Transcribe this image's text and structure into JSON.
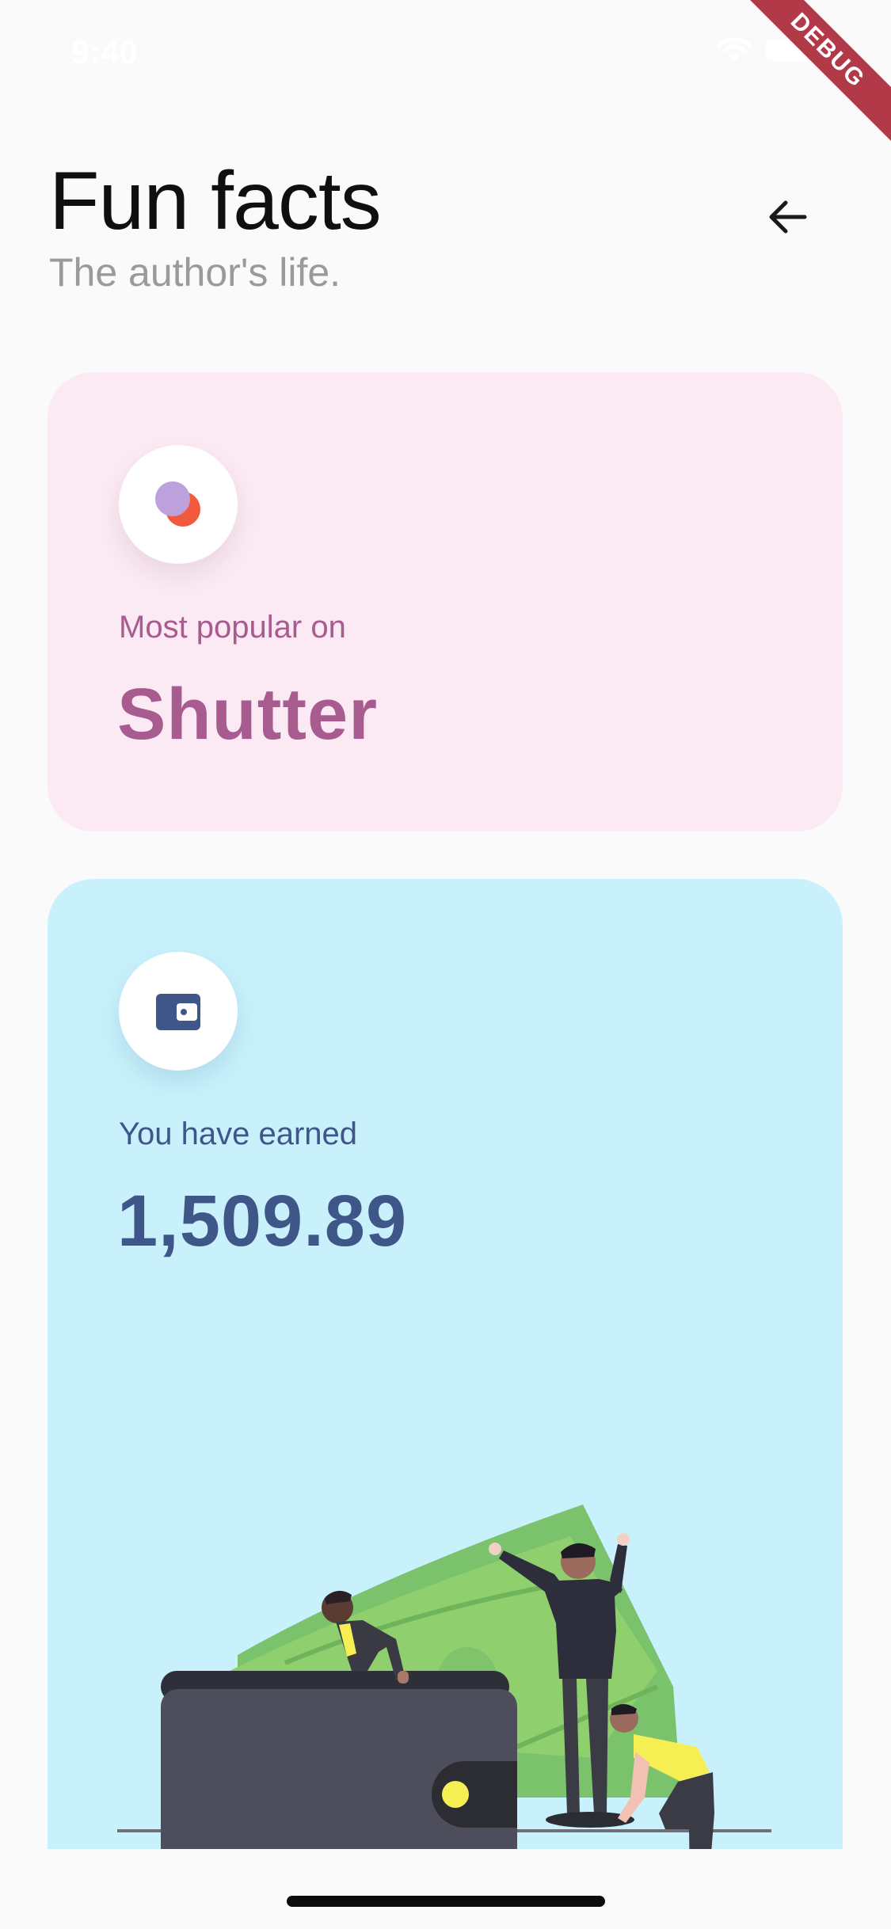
{
  "status_bar": {
    "time": "9:40",
    "debug_label": "DEBUG"
  },
  "header": {
    "title": "Fun facts",
    "subtitle": "The author's life."
  },
  "cards": [
    {
      "label": "Most popular on",
      "value": "Shutter",
      "icon": "shutter-logo-icon",
      "background": "#fbe9f3",
      "text_color": "#a75b8f"
    },
    {
      "label": "You have earned",
      "value": "1,509.89",
      "icon": "wallet-icon",
      "background": "#c8f1fc",
      "text_color": "#3f5688"
    }
  ],
  "icons": {
    "back": "arrow-left-icon",
    "wifi": "wifi-icon",
    "battery": "battery-icon"
  }
}
